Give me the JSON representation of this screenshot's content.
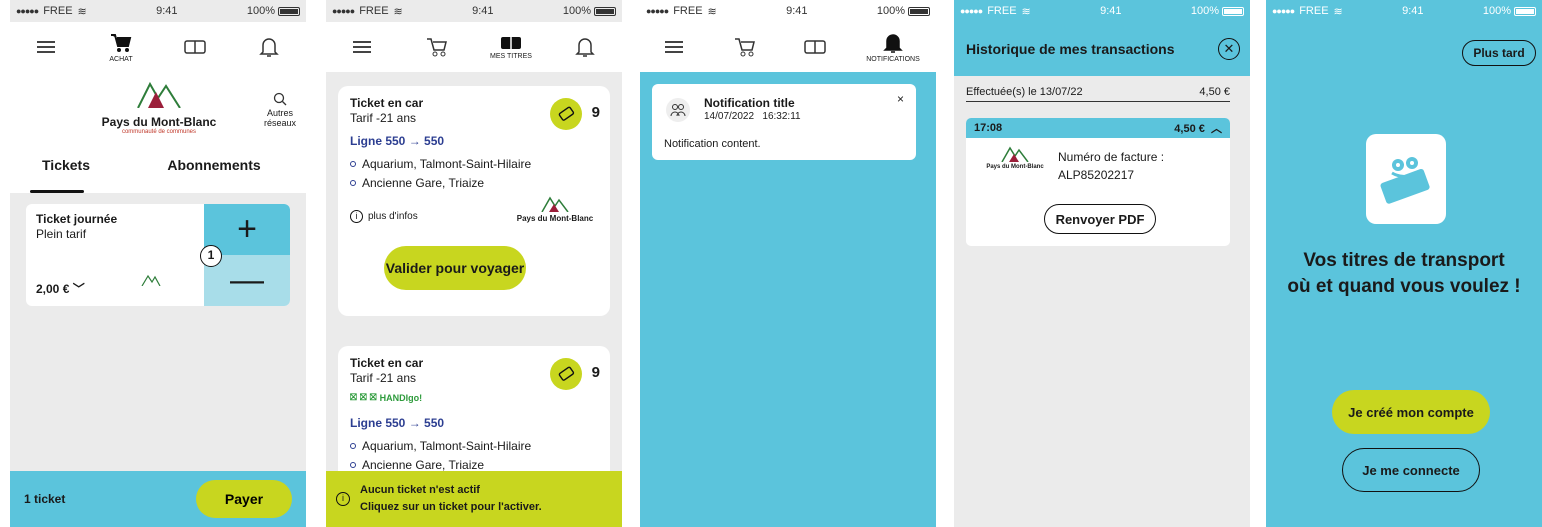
{
  "status": {
    "carrier": "FREE",
    "time": "9:41",
    "battery": "100%"
  },
  "nav": {
    "achat": "ACHAT",
    "mes_titres": "MES TITRES",
    "notifications": "NOTIFICATIONS"
  },
  "brand": {
    "name": "Pays du Mont-Blanc",
    "sub": "communauté de communes"
  },
  "screen1": {
    "other_networks": [
      "Autres",
      "réseaux"
    ],
    "tabs": [
      "Tickets",
      "Abonnements"
    ],
    "ticket": {
      "title": "Ticket journée",
      "fare": "Plein tarif",
      "price": "2,00 €",
      "step_marker": "1"
    },
    "bottom": {
      "count": "1 ticket",
      "pay": "Payer"
    }
  },
  "screen2": {
    "cards": [
      {
        "title": "Ticket en car",
        "fare": "Tarif -21 ans",
        "count": "9",
        "line": "Ligne 550 → 550",
        "stops": [
          "Aquarium, Talmont-Saint-Hilaire",
          "Ancienne Gare, Triaize"
        ],
        "more": "plus d'infos",
        "validate": "Valider pour voyager"
      },
      {
        "title": "Ticket en car",
        "fare": "Tarif -21 ans",
        "count": "9",
        "handi": "HANDIgo!",
        "line": "Ligne 550 → 550",
        "stops": [
          "Aquarium, Talmont-Saint-Hilaire",
          "Ancienne Gare, Triaize"
        ]
      }
    ],
    "alert": {
      "line1": "Aucun ticket n'est actif",
      "line2": "Cliquez sur un ticket pour l'activer."
    }
  },
  "screen3": {
    "notification": {
      "title": "Notification title",
      "date": "14/07/2022",
      "time": "16:32:11",
      "content": "Notification content.",
      "close": "×"
    }
  },
  "screen4": {
    "title": "Historique de mes transactions",
    "date_row": {
      "label": "Effectuée(s) le 13/07/22",
      "amount": "4,50 €"
    },
    "txn": {
      "time": "17:08",
      "amount": "4,50 €",
      "invoice_label": "Numéro de facture :",
      "invoice_number": "ALP85202217",
      "resend": "Renvoyer PDF"
    }
  },
  "screen5": {
    "later": "Plus tard",
    "headline": [
      "Vos titres de transport",
      "où et quand vous voulez !"
    ],
    "create": "Je créé mon compte",
    "login": "Je me connecte"
  },
  "colors": {
    "cyan": "#5bc4dc",
    "lime": "#c8d61f",
    "light_cyan": "#a8dde9",
    "navy": "#2c3e91",
    "background": "#ebebeb"
  }
}
